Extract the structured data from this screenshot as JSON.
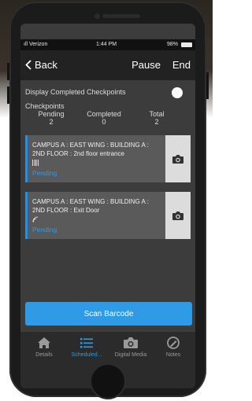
{
  "status_bar": {
    "carrier": "ıll Verizon",
    "time": "1:44 PM",
    "battery": "98%"
  },
  "nav": {
    "back_label": "Back",
    "pause_label": "Pause",
    "end_label": "End"
  },
  "options": {
    "display_completed_label": "Display Completed Checkpoints"
  },
  "checkpoints": {
    "title": "Checkpoints",
    "pending_label": "Pending",
    "completed_label": "Completed",
    "total_label": "Total",
    "pending_value": "2",
    "completed_value": "0",
    "total_value": "2",
    "items": [
      {
        "text": "CAMPUS A : EAST WING : BUILDING A : 2ND FLOOR : 2nd floor entrance",
        "status": "Pending",
        "type_icon": "barcode-icon"
      },
      {
        "text": "CAMPUS A : EAST WING : BUILDING A : 2ND FLOOR : Exit Door",
        "status": "Pending",
        "type_icon": "nfc-icon"
      }
    ]
  },
  "scan_button": {
    "label": "Scan Barcode"
  },
  "tabs": [
    {
      "label": "Details",
      "icon": "house-icon"
    },
    {
      "label": "Scheduled...",
      "icon": "list-icon"
    },
    {
      "label": "Digital Media",
      "icon": "camera-icon"
    },
    {
      "label": "Notes",
      "icon": "note-icon"
    }
  ],
  "colors": {
    "accent": "#2f9be6",
    "screen_bg": "#3c3c3c",
    "card_bg": "#5a5a5a"
  }
}
